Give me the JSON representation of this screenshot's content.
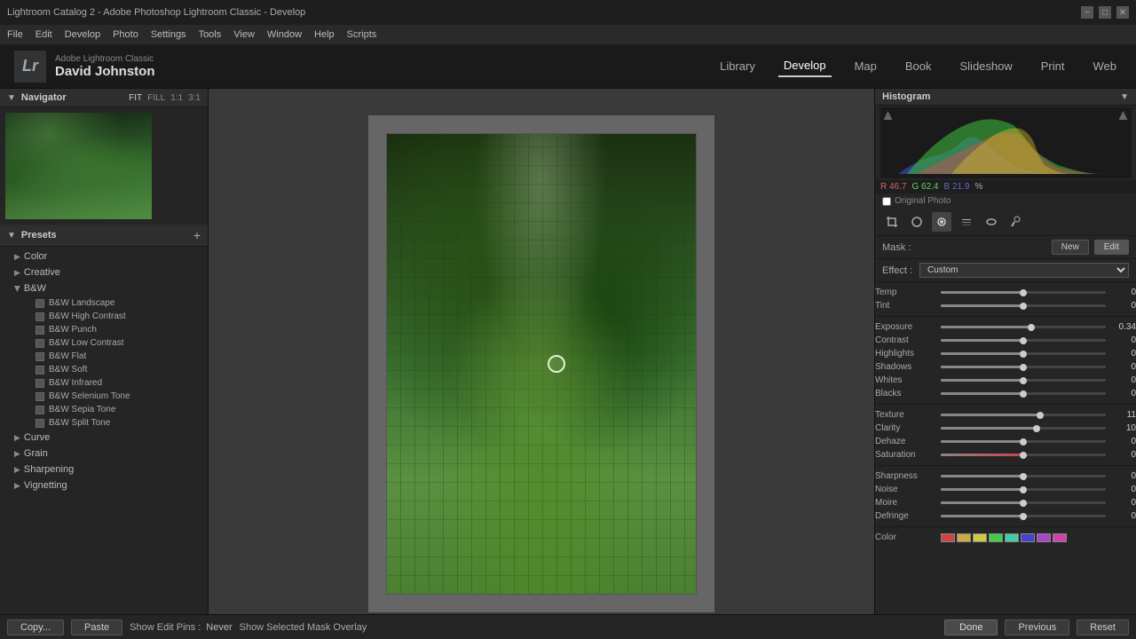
{
  "titlebar": {
    "title": "Lightroom Catalog 2 - Adobe Photoshop Lightroom Classic - Develop",
    "minimize": "−",
    "maximize": "□",
    "close": "✕"
  },
  "menubar": {
    "items": [
      "File",
      "Edit",
      "Develop",
      "Photo",
      "Settings",
      "Tools",
      "View",
      "Window",
      "Help",
      "Scripts"
    ]
  },
  "topnav": {
    "logo": "Lr",
    "app_name": "Adobe Lightroom Classic",
    "user_name": "David Johnston",
    "nav_items": [
      "Library",
      "Develop",
      "Map",
      "Book",
      "Slideshow",
      "Print",
      "Web"
    ]
  },
  "navigator": {
    "title": "Navigator",
    "view_fit": "FIT",
    "view_fill": "FILL",
    "view_1_1": "1:1",
    "view_3_1": "3:1"
  },
  "presets": {
    "title": "Presets",
    "categories": [
      {
        "name": "Color",
        "expanded": false,
        "items": []
      },
      {
        "name": "Creative",
        "expanded": false,
        "items": []
      },
      {
        "name": "B&W",
        "expanded": true,
        "items": [
          "B&W Landscape",
          "B&W High Contrast",
          "B&W Punch",
          "B&W Low Contrast",
          "B&W Flat",
          "B&W Soft",
          "B&W Infrared",
          "B&W Selenium Tone",
          "B&W Sepia Tone",
          "B&W Split Tone"
        ]
      },
      {
        "name": "Curve",
        "expanded": false,
        "items": []
      },
      {
        "name": "Grain",
        "expanded": false,
        "items": []
      },
      {
        "name": "Sharpening",
        "expanded": false,
        "items": []
      },
      {
        "name": "Vignetting",
        "expanded": false,
        "items": []
      }
    ]
  },
  "histogram": {
    "title": "Histogram",
    "r_value": "46.7",
    "g_value": "62.4",
    "b_value": "21.9",
    "r_label": "R",
    "g_label": "G",
    "b_label": "B",
    "percent": "%"
  },
  "orig_photo": {
    "label": "Original Photo"
  },
  "mask": {
    "label": "Mask :",
    "new_btn": "New",
    "edit_btn": "Edit"
  },
  "effect": {
    "label": "Effect :",
    "value": "Custom"
  },
  "sliders": {
    "temp_label": "Temp",
    "temp_value": "0",
    "tint_label": "Tint",
    "tint_value": "0",
    "exposure_label": "Exposure",
    "exposure_value": "0.34",
    "contrast_label": "Contrast",
    "contrast_value": "0",
    "highlights_label": "Highlights",
    "highlights_value": "0",
    "shadows_label": "Shadows",
    "shadows_value": "0",
    "whites_label": "Whites",
    "whites_value": "0",
    "blacks_label": "Blacks",
    "blacks_value": "0",
    "texture_label": "Texture",
    "texture_value": "11",
    "clarity_label": "Clarity",
    "clarity_value": "10",
    "dehaze_label": "Dehaze",
    "dehaze_value": "0",
    "saturation_label": "Saturation",
    "saturation_value": "0",
    "sharpness_label": "Sharpness",
    "sharpness_value": "0",
    "noise_label": "Noise",
    "noise_value": "0",
    "moire_label": "Moire",
    "moire_value": "0",
    "defringe_label": "Defringe",
    "defringe_value": "0",
    "color_label": "Color"
  },
  "bottom_bar": {
    "copy_btn": "Copy...",
    "paste_btn": "Paste",
    "show_edit_pins_label": "Show Edit Pins :",
    "show_edit_pins_value": "Never",
    "show_mask_label": "Show Selected Mask Overlay",
    "done_btn": "Done",
    "previous_btn": "Previous",
    "reset_btn": "Reset"
  }
}
